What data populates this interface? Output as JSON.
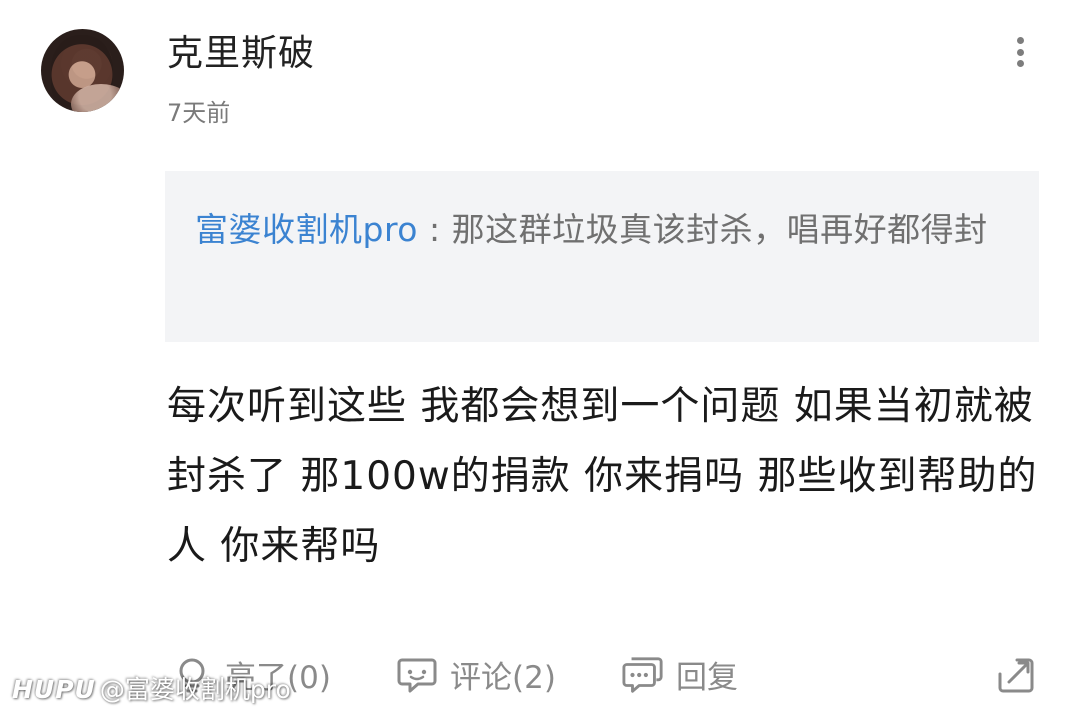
{
  "comment": {
    "username": "克里斯破",
    "time": "7天前",
    "quote": {
      "author": "富婆收割机pro",
      "separator": " : ",
      "text": "那这群垃圾真该封杀，唱再好都得封"
    },
    "text": "每次听到这些 我都会想到一个问题 如果当初就被封杀了 那100w的捐款 你来捐吗 那些收到帮助的人 你来帮吗"
  },
  "actions": {
    "light_label": "亮了(0)",
    "comment_label": "评论(2)",
    "reply_label": "回复"
  },
  "watermark": {
    "brand": "HUPU",
    "user": "@富婆收割机pro"
  },
  "icons": {
    "more": "more-vertical-icon",
    "light": "lightbulb-icon",
    "comment": "comment-bubble-icon",
    "reply": "reply-bubble-icon",
    "share": "share-icon"
  },
  "colors": {
    "quote_author": "#3b83d1",
    "quote_background": "#f3f4f6",
    "secondary_text": "#8a8a8a"
  }
}
